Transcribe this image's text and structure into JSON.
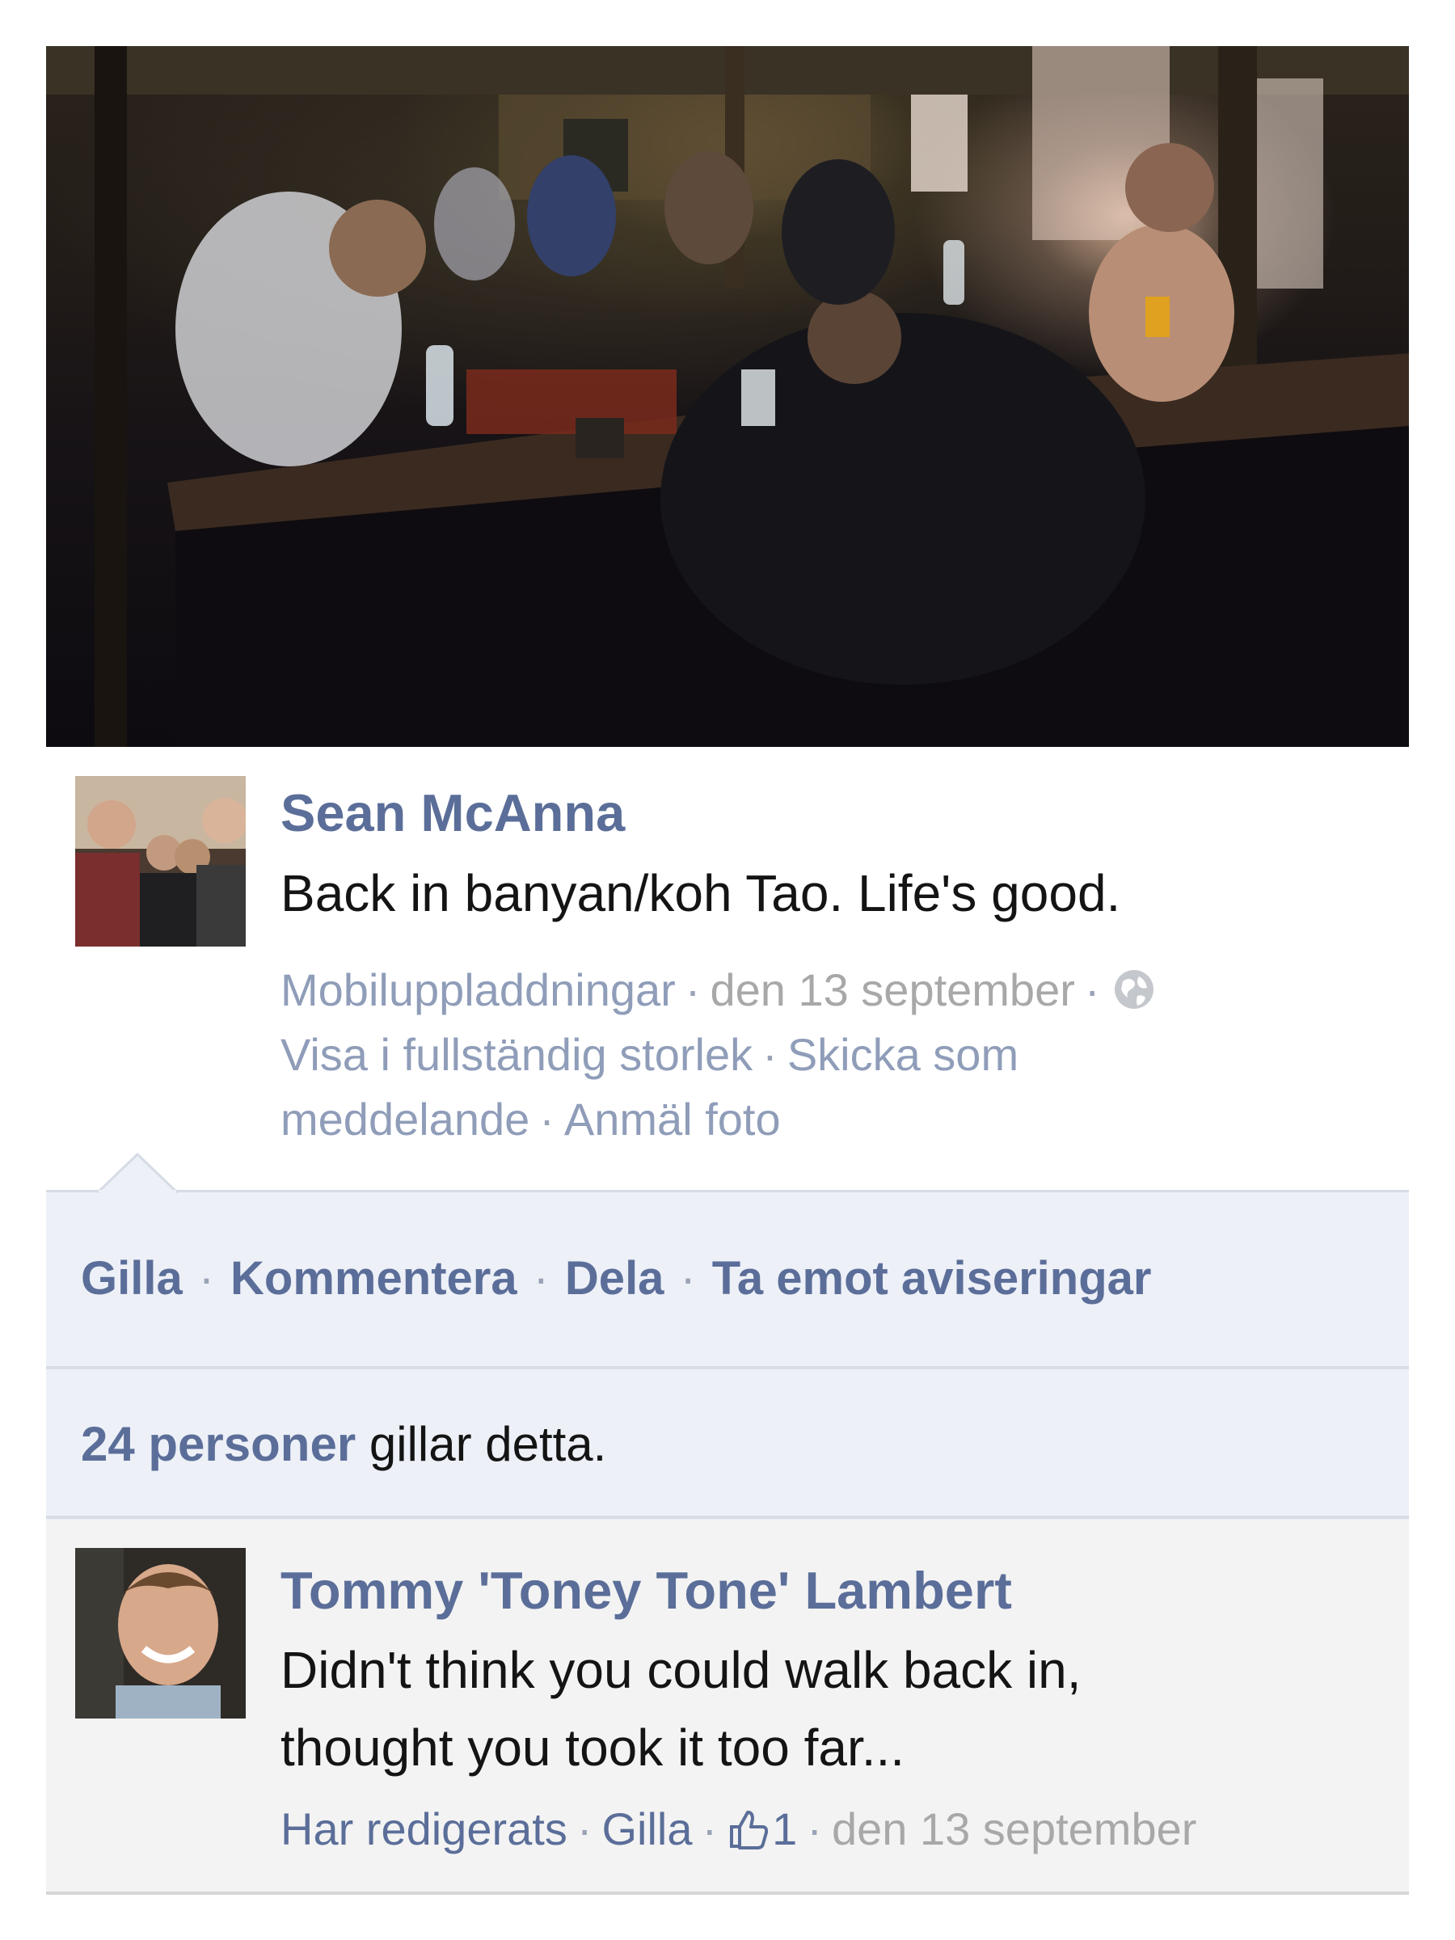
{
  "photo": {
    "icon": "photo-of-bar-at-night"
  },
  "post": {
    "author": "Sean McAnna",
    "text": "Back in banyan/koh Tao. Life's good.",
    "album": "Mobiluppladdningar",
    "date": "den 13 september",
    "privacy_icon": "globe-icon",
    "view_full_size": "Visa i fullständig storlek",
    "send_as_message_1": "Skicka som",
    "send_as_message_2": "meddelande",
    "report_photo": "Anmäl foto"
  },
  "actions": {
    "like": "Gilla",
    "comment": "Kommentera",
    "share": "Dela",
    "notifications": "Ta emot aviseringar"
  },
  "likes": {
    "count": "24 personer",
    "suffix": "gillar detta."
  },
  "comment": {
    "author": "Tommy 'Toney Tone' Lambert",
    "text_line1": "Didn't think you could walk back in,",
    "text_line2": "thought you took it too far...",
    "edited": "Har redigerats",
    "like": "Gilla",
    "like_icon": "thumbs-up-icon",
    "like_count": "1",
    "date": "den 13 september"
  },
  "colors": {
    "link_blue": "#5b6e99",
    "muted_link": "#8f9db9",
    "action_bg": "#edf0f7",
    "comment_bg": "#f3f3f3"
  }
}
